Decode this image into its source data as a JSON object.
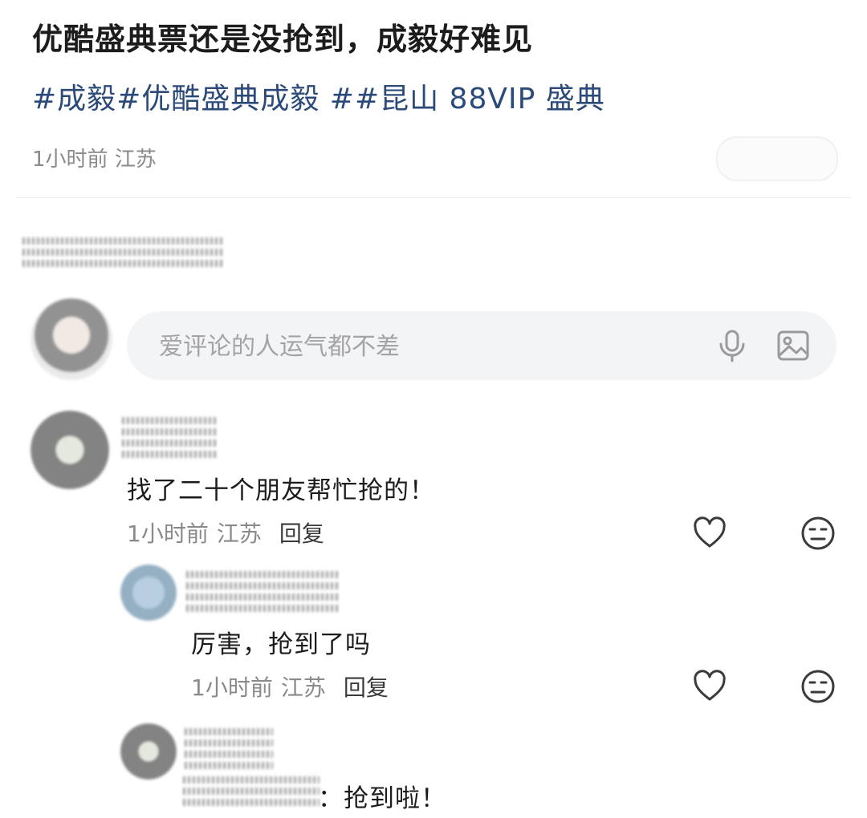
{
  "post": {
    "title": "优酷盛典票还是没抢到，成毅好难见",
    "hashtags": [
      "#成毅",
      "#优酷盛典成毅",
      " ##昆山 88VIP 盛典"
    ],
    "time": "1小时前",
    "location": "江苏"
  },
  "comment_box": {
    "placeholder": "爱评论的人运气都不差",
    "icons": [
      "mic-icon",
      "image-icon"
    ]
  },
  "comments": [
    {
      "text": "找了二十个朋友帮忙抢的！",
      "time": "1小时前",
      "location": "江苏",
      "reply_label": "回复",
      "icons": [
        "heart-icon",
        "meh-icon"
      ]
    },
    {
      "text": "厉害，抢到了吗",
      "time": "1小时前",
      "location": "江苏",
      "reply_label": "回复",
      "icons": [
        "heart-icon",
        "meh-icon"
      ]
    },
    {
      "text": "：抢到啦！"
    }
  ],
  "colors": {
    "hashtag": "#2b4a7a",
    "meta": "#8a8a8a",
    "input_bg": "#f3f4f6"
  }
}
